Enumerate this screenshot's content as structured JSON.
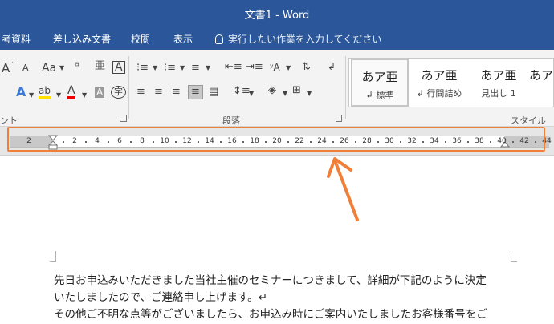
{
  "window": {
    "title": "文書1 - Word"
  },
  "menu": {
    "tabs": [
      "考資料",
      "差し込み文書",
      "校閲",
      "表示"
    ],
    "tell_me": "実行したい作業を入力してください"
  },
  "ribbon": {
    "groups": {
      "font_partial": "ント",
      "paragraph": "段落",
      "styles": "スタイル"
    },
    "font_buttons": [
      "A",
      "Aa",
      "A"
    ],
    "styles": [
      {
        "sample": "あア亜",
        "name": "標準",
        "marker": "↲",
        "selected": true
      },
      {
        "sample": "あア亜",
        "name": "行間詰め",
        "marker": "↲",
        "selected": false
      },
      {
        "sample": "あア亜",
        "name": "見出し 1",
        "marker": "",
        "selected": false
      },
      {
        "sample": "あア",
        "name": "",
        "marker": "",
        "selected": false
      }
    ]
  },
  "ruler": {
    "left_margin_label": "2",
    "numbers": [
      "2",
      "4",
      "6",
      "8",
      "10",
      "12",
      "14",
      "16",
      "18",
      "20",
      "22",
      "24",
      "26",
      "28",
      "30",
      "32",
      "34",
      "36",
      "38",
      "40",
      "42",
      "44"
    ]
  },
  "document": {
    "lines": [
      "先日お申込みいただきました当社主催のセミナーにつきまして、詳細が下記のように決定",
      "いたしましたので、ご連絡申し上げます。↵",
      "その他ご不明な点等がございましたら、お申込み時にご案内いたしましたお客様番号をご"
    ]
  },
  "colors": {
    "title_bar": "#2b579a",
    "highlight": "#f07f3a",
    "ribbon_bg": "#f3f3f3"
  }
}
